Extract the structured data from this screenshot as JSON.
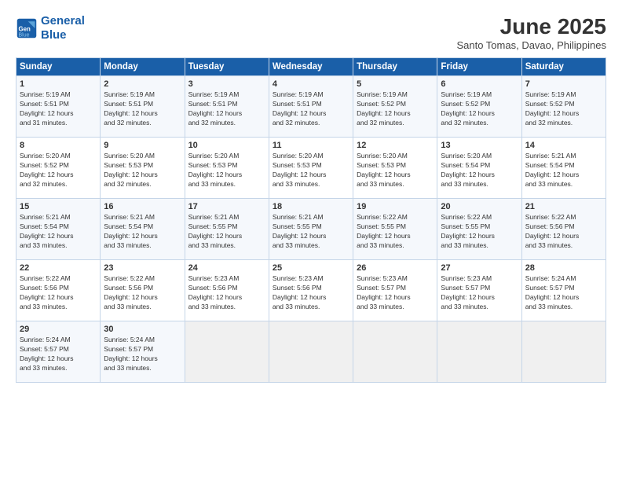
{
  "header": {
    "logo_line1": "General",
    "logo_line2": "Blue",
    "month": "June 2025",
    "location": "Santo Tomas, Davao, Philippines"
  },
  "columns": [
    "Sunday",
    "Monday",
    "Tuesday",
    "Wednesday",
    "Thursday",
    "Friday",
    "Saturday"
  ],
  "rows": [
    [
      {
        "day": "1",
        "lines": [
          "Sunrise: 5:19 AM",
          "Sunset: 5:51 PM",
          "Daylight: 12 hours",
          "and 31 minutes."
        ]
      },
      {
        "day": "2",
        "lines": [
          "Sunrise: 5:19 AM",
          "Sunset: 5:51 PM",
          "Daylight: 12 hours",
          "and 32 minutes."
        ]
      },
      {
        "day": "3",
        "lines": [
          "Sunrise: 5:19 AM",
          "Sunset: 5:51 PM",
          "Daylight: 12 hours",
          "and 32 minutes."
        ]
      },
      {
        "day": "4",
        "lines": [
          "Sunrise: 5:19 AM",
          "Sunset: 5:51 PM",
          "Daylight: 12 hours",
          "and 32 minutes."
        ]
      },
      {
        "day": "5",
        "lines": [
          "Sunrise: 5:19 AM",
          "Sunset: 5:52 PM",
          "Daylight: 12 hours",
          "and 32 minutes."
        ]
      },
      {
        "day": "6",
        "lines": [
          "Sunrise: 5:19 AM",
          "Sunset: 5:52 PM",
          "Daylight: 12 hours",
          "and 32 minutes."
        ]
      },
      {
        "day": "7",
        "lines": [
          "Sunrise: 5:19 AM",
          "Sunset: 5:52 PM",
          "Daylight: 12 hours",
          "and 32 minutes."
        ]
      }
    ],
    [
      {
        "day": "8",
        "lines": [
          "Sunrise: 5:20 AM",
          "Sunset: 5:52 PM",
          "Daylight: 12 hours",
          "and 32 minutes."
        ]
      },
      {
        "day": "9",
        "lines": [
          "Sunrise: 5:20 AM",
          "Sunset: 5:53 PM",
          "Daylight: 12 hours",
          "and 32 minutes."
        ]
      },
      {
        "day": "10",
        "lines": [
          "Sunrise: 5:20 AM",
          "Sunset: 5:53 PM",
          "Daylight: 12 hours",
          "and 33 minutes."
        ]
      },
      {
        "day": "11",
        "lines": [
          "Sunrise: 5:20 AM",
          "Sunset: 5:53 PM",
          "Daylight: 12 hours",
          "and 33 minutes."
        ]
      },
      {
        "day": "12",
        "lines": [
          "Sunrise: 5:20 AM",
          "Sunset: 5:53 PM",
          "Daylight: 12 hours",
          "and 33 minutes."
        ]
      },
      {
        "day": "13",
        "lines": [
          "Sunrise: 5:20 AM",
          "Sunset: 5:54 PM",
          "Daylight: 12 hours",
          "and 33 minutes."
        ]
      },
      {
        "day": "14",
        "lines": [
          "Sunrise: 5:21 AM",
          "Sunset: 5:54 PM",
          "Daylight: 12 hours",
          "and 33 minutes."
        ]
      }
    ],
    [
      {
        "day": "15",
        "lines": [
          "Sunrise: 5:21 AM",
          "Sunset: 5:54 PM",
          "Daylight: 12 hours",
          "and 33 minutes."
        ]
      },
      {
        "day": "16",
        "lines": [
          "Sunrise: 5:21 AM",
          "Sunset: 5:54 PM",
          "Daylight: 12 hours",
          "and 33 minutes."
        ]
      },
      {
        "day": "17",
        "lines": [
          "Sunrise: 5:21 AM",
          "Sunset: 5:55 PM",
          "Daylight: 12 hours",
          "and 33 minutes."
        ]
      },
      {
        "day": "18",
        "lines": [
          "Sunrise: 5:21 AM",
          "Sunset: 5:55 PM",
          "Daylight: 12 hours",
          "and 33 minutes."
        ]
      },
      {
        "day": "19",
        "lines": [
          "Sunrise: 5:22 AM",
          "Sunset: 5:55 PM",
          "Daylight: 12 hours",
          "and 33 minutes."
        ]
      },
      {
        "day": "20",
        "lines": [
          "Sunrise: 5:22 AM",
          "Sunset: 5:55 PM",
          "Daylight: 12 hours",
          "and 33 minutes."
        ]
      },
      {
        "day": "21",
        "lines": [
          "Sunrise: 5:22 AM",
          "Sunset: 5:56 PM",
          "Daylight: 12 hours",
          "and 33 minutes."
        ]
      }
    ],
    [
      {
        "day": "22",
        "lines": [
          "Sunrise: 5:22 AM",
          "Sunset: 5:56 PM",
          "Daylight: 12 hours",
          "and 33 minutes."
        ]
      },
      {
        "day": "23",
        "lines": [
          "Sunrise: 5:22 AM",
          "Sunset: 5:56 PM",
          "Daylight: 12 hours",
          "and 33 minutes."
        ]
      },
      {
        "day": "24",
        "lines": [
          "Sunrise: 5:23 AM",
          "Sunset: 5:56 PM",
          "Daylight: 12 hours",
          "and 33 minutes."
        ]
      },
      {
        "day": "25",
        "lines": [
          "Sunrise: 5:23 AM",
          "Sunset: 5:56 PM",
          "Daylight: 12 hours",
          "and 33 minutes."
        ]
      },
      {
        "day": "26",
        "lines": [
          "Sunrise: 5:23 AM",
          "Sunset: 5:57 PM",
          "Daylight: 12 hours",
          "and 33 minutes."
        ]
      },
      {
        "day": "27",
        "lines": [
          "Sunrise: 5:23 AM",
          "Sunset: 5:57 PM",
          "Daylight: 12 hours",
          "and 33 minutes."
        ]
      },
      {
        "day": "28",
        "lines": [
          "Sunrise: 5:24 AM",
          "Sunset: 5:57 PM",
          "Daylight: 12 hours",
          "and 33 minutes."
        ]
      }
    ],
    [
      {
        "day": "29",
        "lines": [
          "Sunrise: 5:24 AM",
          "Sunset: 5:57 PM",
          "Daylight: 12 hours",
          "and 33 minutes."
        ]
      },
      {
        "day": "30",
        "lines": [
          "Sunrise: 5:24 AM",
          "Sunset: 5:57 PM",
          "Daylight: 12 hours",
          "and 33 minutes."
        ]
      },
      null,
      null,
      null,
      null,
      null
    ]
  ]
}
